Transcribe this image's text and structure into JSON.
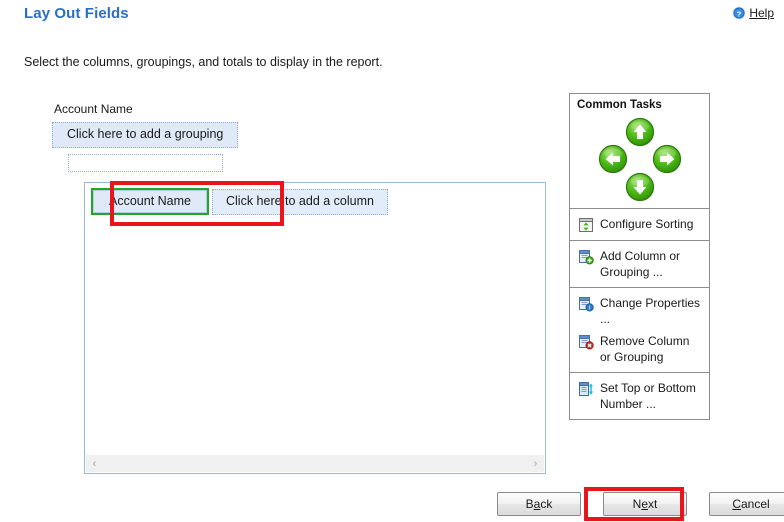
{
  "header": {
    "title": "Lay Out Fields",
    "help_label": "Help",
    "help_icon": "help-circle-icon",
    "title_color": "#2b6fc4"
  },
  "instruction": "Select the columns, groupings, and totals to display in the report.",
  "grouping_area": {
    "field_label": "Account Name",
    "add_grouping_label": "Click here to add a grouping",
    "empty_slot_label": ""
  },
  "report_designer": {
    "columns": [
      {
        "label": "Account Name",
        "selected": true,
        "selection_color": "#22a722"
      },
      {
        "label": "Click here to add a column",
        "selected": false,
        "placeholder": true
      }
    ],
    "scrollbar": {
      "left_arrow": "‹",
      "right_arrow": "›"
    }
  },
  "common_tasks": {
    "title": "Common Tasks",
    "nav_buttons": [
      {
        "name": "move-up-button",
        "direction": "up",
        "icon": "arrow-up-icon"
      },
      {
        "name": "move-left-button",
        "direction": "left",
        "icon": "arrow-left-icon"
      },
      {
        "name": "move-right-button",
        "direction": "right",
        "icon": "arrow-right-icon"
      },
      {
        "name": "move-down-button",
        "direction": "down",
        "icon": "arrow-down-icon"
      }
    ],
    "groups": [
      {
        "items": [
          {
            "label": "Configure Sorting",
            "icon": "sort-icon"
          }
        ]
      },
      {
        "items": [
          {
            "label": "Add Column or Grouping ...",
            "icon": "add-column-icon"
          }
        ]
      },
      {
        "items": [
          {
            "label": "Change Properties ...",
            "icon": "properties-icon"
          },
          {
            "label": "Remove Column or Grouping",
            "icon": "remove-column-icon"
          }
        ]
      },
      {
        "items": [
          {
            "label": "Set Top or Bottom Number ...",
            "icon": "top-bottom-icon"
          }
        ]
      }
    ]
  },
  "footer": {
    "buttons": [
      {
        "name": "back-button",
        "prefix": "B",
        "accel": "a",
        "suffix": "ck",
        "highlighted": false
      },
      {
        "name": "next-button",
        "prefix": "N",
        "accel": "e",
        "suffix": "xt",
        "highlighted": true
      },
      {
        "name": "cancel-button",
        "prefix": "",
        "accel": "C",
        "suffix": "ancel",
        "highlighted": false
      }
    ]
  },
  "annotations": {
    "highlight_color": "#e8161a",
    "targets": [
      "add-column-cell",
      "next-button"
    ]
  }
}
